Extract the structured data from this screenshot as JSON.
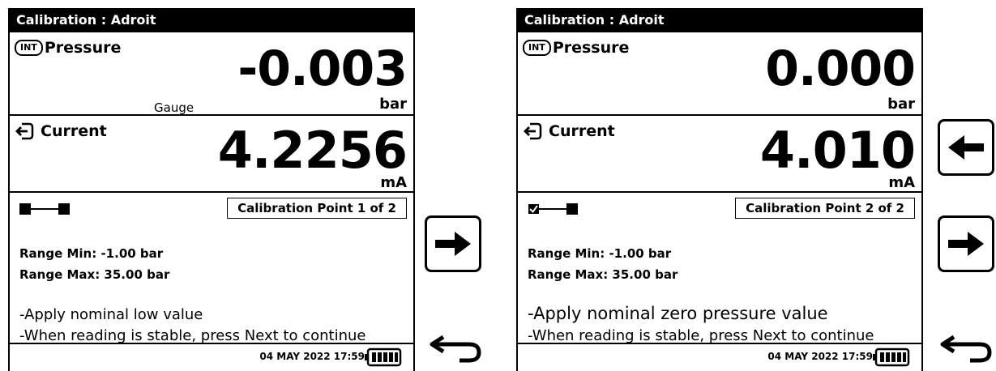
{
  "screens": [
    {
      "title": "Calibration : Adroit",
      "pressure": {
        "badge": "INT",
        "label": "Pressure",
        "value": "-0.003",
        "unit": "bar",
        "mode": "Gauge"
      },
      "current": {
        "label": "Current",
        "value": "4.2256",
        "unit": "mA"
      },
      "calibration": {
        "point_label": "Calibration Point 1 of 2",
        "points_done": 0,
        "points_total": 2,
        "range_min": "Range Min: -1.00 bar",
        "range_max": "Range Max: 35.00 bar",
        "instruction_1": "-Apply nominal low value",
        "instruction_2": "-When reading is stable, press Next to continue"
      },
      "status": {
        "datetime": "04 MAY 2022 17:59",
        "battery_level": 1.0
      }
    },
    {
      "title": "Calibration : Adroit",
      "pressure": {
        "badge": "INT",
        "label": "Pressure",
        "value": "0.000",
        "unit": "bar",
        "mode": ""
      },
      "current": {
        "label": "Current",
        "value": "4.010",
        "unit": "mA"
      },
      "calibration": {
        "point_label": "Calibration Point 2 of 2",
        "points_done": 1,
        "points_total": 2,
        "range_min": "Range Min: -1.00 bar",
        "range_max": "Range Max: 35.00 bar",
        "instruction_1": "-Apply nominal zero pressure value",
        "instruction_2": "-When reading is stable, press Next to continue"
      },
      "status": {
        "datetime": "04 MAY 2022 17:59",
        "battery_level": 1.0
      }
    }
  ],
  "buttons": {
    "left_next": {
      "icon": "arrow-right-icon"
    },
    "left_back": {
      "icon": "return-arrow-icon"
    },
    "right_prev": {
      "icon": "arrow-left-icon"
    },
    "right_next": {
      "icon": "arrow-right-icon"
    },
    "right_back": {
      "icon": "return-arrow-icon"
    }
  }
}
